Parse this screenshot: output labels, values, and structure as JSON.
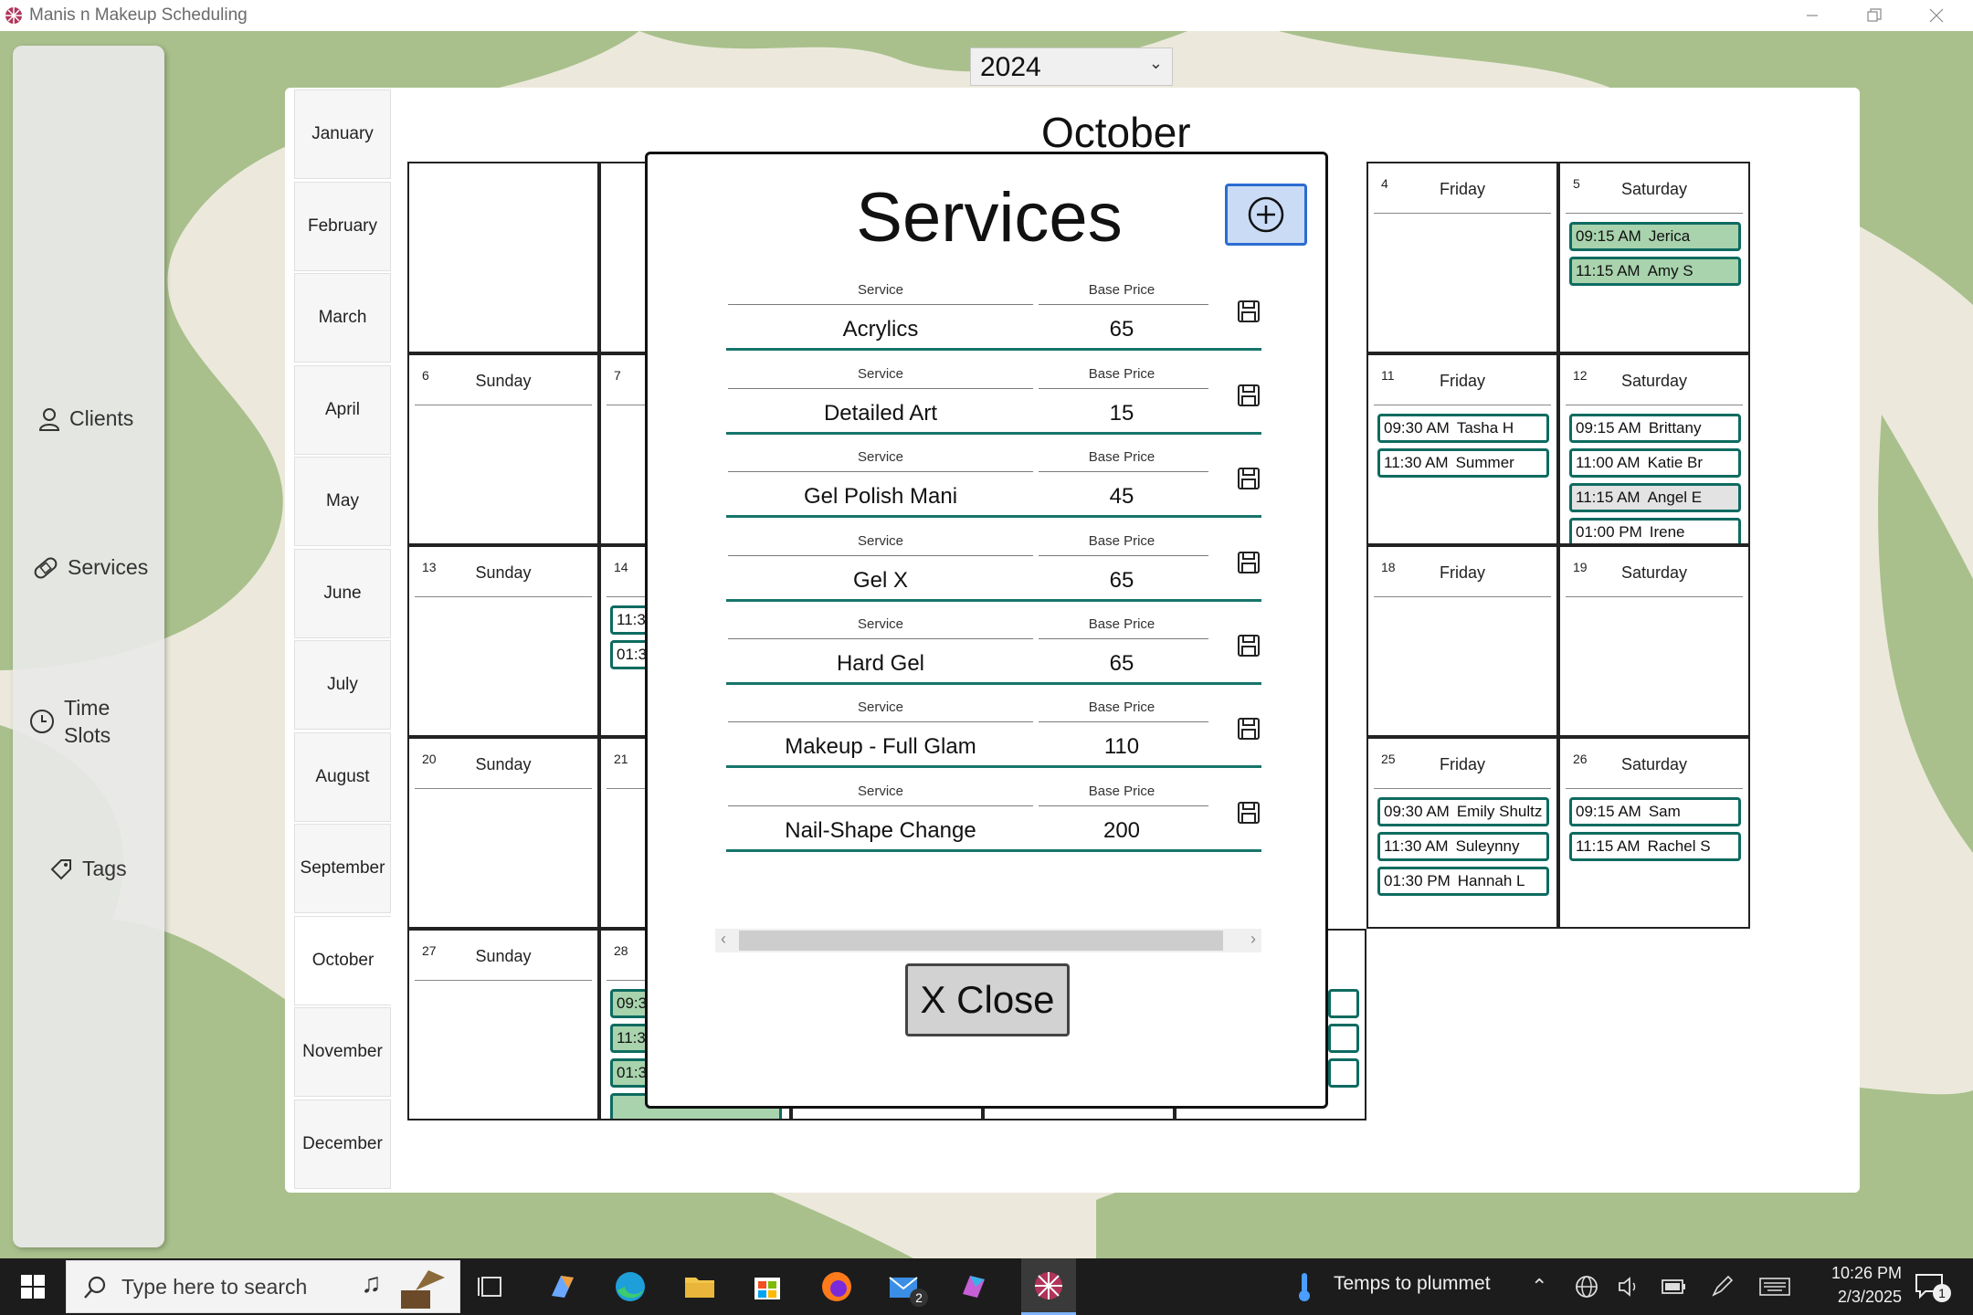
{
  "window": {
    "title": "Manis n Makeup Scheduling"
  },
  "sidebar": {
    "items": [
      {
        "label": "Clients"
      },
      {
        "label": "Services"
      },
      {
        "label": "Time\nSlots"
      },
      {
        "label": "Tags"
      }
    ]
  },
  "calendar": {
    "year": "2024",
    "month_title": "October",
    "months": [
      "January",
      "February",
      "March",
      "April",
      "May",
      "June",
      "July",
      "August",
      "September",
      "October",
      "November",
      "December"
    ],
    "selected_month": "October",
    "days": [
      {
        "num": "4",
        "name": "Friday",
        "appts": []
      },
      {
        "num": "5",
        "name": "Saturday",
        "appts": [
          {
            "time": "09:15 AM",
            "name": "Jerica"
          },
          {
            "time": "11:15 AM",
            "name": "Amy S"
          }
        ]
      },
      {
        "num": "6",
        "name": "Sunday",
        "appts": []
      },
      {
        "num": "7",
        "name": "",
        "appts": []
      },
      {
        "num": "11",
        "name": "Friday",
        "appts": [
          {
            "time": "09:30 AM",
            "name": "Tasha H"
          },
          {
            "time": "11:30 AM",
            "name": "Summer"
          }
        ]
      },
      {
        "num": "12",
        "name": "Saturday",
        "appts": [
          {
            "time": "09:15 AM",
            "name": "Brittany"
          },
          {
            "time": "11:00 AM",
            "name": "Katie Br"
          },
          {
            "time": "11:15 AM",
            "name": "Angel E"
          },
          {
            "time": "01:00 PM",
            "name": "Irene"
          }
        ]
      },
      {
        "num": "13",
        "name": "Sunday",
        "appts": []
      },
      {
        "num": "14",
        "name": "",
        "appts": [
          {
            "time": "11:3",
            "name": ""
          },
          {
            "time": "01:3",
            "name": ""
          }
        ]
      },
      {
        "num": "18",
        "name": "Friday",
        "appts": []
      },
      {
        "num": "19",
        "name": "Saturday",
        "appts": []
      },
      {
        "num": "20",
        "name": "Sunday",
        "appts": []
      },
      {
        "num": "21",
        "name": "",
        "appts": []
      },
      {
        "num": "25",
        "name": "Friday",
        "appts": [
          {
            "time": "09:30 AM",
            "name": "Emily Shultz"
          },
          {
            "time": "11:30 AM",
            "name": "Suleynny"
          },
          {
            "time": "01:30 PM",
            "name": "Hannah L"
          }
        ]
      },
      {
        "num": "26",
        "name": "Saturday",
        "appts": [
          {
            "time": "09:15 AM",
            "name": "Sam"
          },
          {
            "time": "11:15 AM",
            "name": "Rachel S"
          }
        ]
      },
      {
        "num": "27",
        "name": "Sunday",
        "appts": []
      },
      {
        "num": "28",
        "name": "",
        "appts": [
          {
            "time": "09:3",
            "name": ""
          },
          {
            "time": "11:3",
            "name": ""
          },
          {
            "time": "01:3",
            "name": ""
          }
        ]
      }
    ]
  },
  "dialog": {
    "title": "Services",
    "add_button": "plus-circle-icon",
    "column_service": "Service",
    "column_price": "Base Price",
    "services": [
      {
        "name": "Acrylics",
        "price": "65"
      },
      {
        "name": "Detailed Art",
        "price": "15"
      },
      {
        "name": "Gel Polish Mani",
        "price": "45"
      },
      {
        "name": "Gel X",
        "price": "65"
      },
      {
        "name": "Hard Gel",
        "price": "65"
      },
      {
        "name": "Makeup - Full Glam",
        "price": "110"
      },
      {
        "name": "Nail-Shape Change",
        "price": "200"
      }
    ],
    "close_label": "X  Close"
  },
  "taskbar": {
    "search_placeholder": "Type here to search",
    "weather": "Temps to plummet",
    "time": "10:26 PM",
    "date": "2/3/2025",
    "mail_badge": "2",
    "notification_badge": "1"
  },
  "colors": {
    "accent_teal": "#0e6b60",
    "appt_green": "#a8d3ad",
    "add_button_bg": "#c9dbf5",
    "bg_green": "#a9c08c"
  }
}
